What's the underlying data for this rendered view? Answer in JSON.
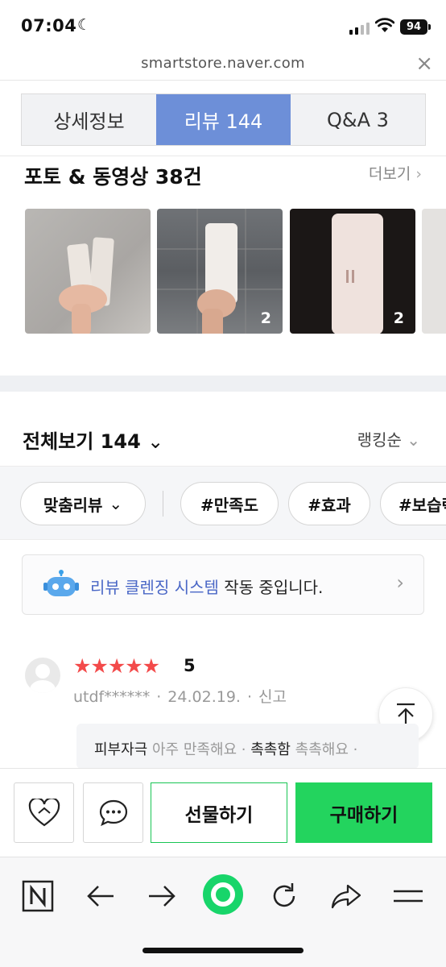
{
  "status": {
    "time": "07:04",
    "battery": "94"
  },
  "browser": {
    "url": "smartstore.naver.com",
    "close": "×"
  },
  "tabs": [
    {
      "label": "상세정보",
      "active": false
    },
    {
      "label": "리뷰 144",
      "active": true
    },
    {
      "label": "Q&A 3",
      "active": false
    }
  ],
  "photos": {
    "title": "포토 & 동영상 38건",
    "more": "더보기",
    "thumbs": [
      {
        "count": ""
      },
      {
        "count": "2"
      },
      {
        "count": "2"
      }
    ]
  },
  "filters": {
    "all": "전체보기 144",
    "sort": "랭킹순",
    "chips": [
      "맞춤리뷰",
      "#만족도",
      "#효과",
      "#보습력"
    ]
  },
  "banner": {
    "highlight": "리뷰 클렌징 시스템",
    "text": " 작동 중입니다."
  },
  "review": {
    "stars": "★★★★★",
    "score": "5",
    "user": "utdf******",
    "date": "24.02.19.",
    "report": "신고",
    "tags": [
      {
        "label": "피부자극",
        "value": "아주 만족해요"
      },
      {
        "label": "촉촉함",
        "value": "촉촉해요"
      }
    ]
  },
  "actions": {
    "gift": "선물하기",
    "buy": "구매하기"
  },
  "colors": {
    "accent_tab": "#6d8fd8",
    "buy_green": "#23d45e",
    "star_red": "#f34a4a",
    "banner_blue": "#4a67c6"
  }
}
